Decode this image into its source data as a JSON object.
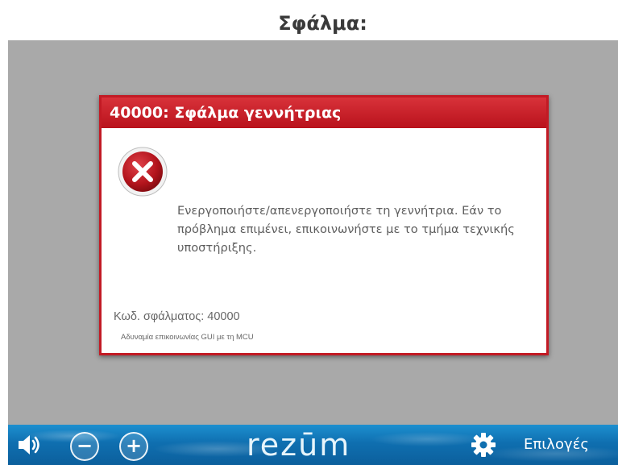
{
  "header": {
    "title": "Σφάλμα:"
  },
  "dialog": {
    "title": "40000: Σφάλμα γεννήτριας",
    "icon": "error-x-icon",
    "message": "Ενεργοποιήστε/απενεργοποιήστε τη γεννήτρια. Εάν το πρόβλημα επιμένει, επικοινωνήστε με το τμήμα τεχνικής υποστήριξης.",
    "error_code": "Κωδ. σφάλματος: 40000",
    "error_detail": "Αδυναμία επικοινωνίας GUI με τη MCU"
  },
  "bottom_bar": {
    "logo": "rezūm",
    "options_label": "Επιλογές",
    "icons": [
      "speaker-icon",
      "minus-icon",
      "plus-icon",
      "gear-icon"
    ]
  },
  "colors": {
    "dialog_red": "#c21a24",
    "screen_gray": "#a9a9a9",
    "bar_blue": "#0f6fb0"
  }
}
